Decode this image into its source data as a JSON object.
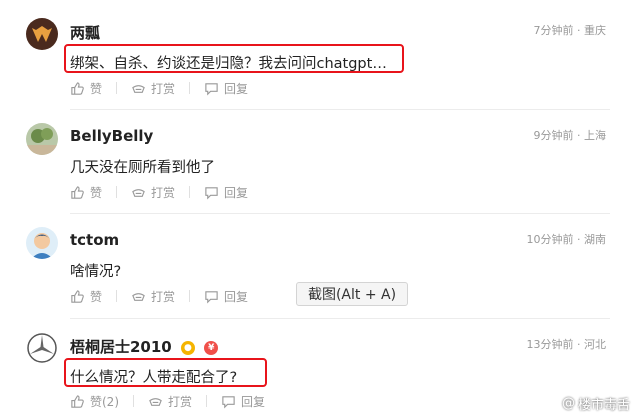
{
  "comments": [
    {
      "username": "两瓢",
      "time": "7分钟前",
      "location": "重庆",
      "text": "绑架、自杀、约谈还是归隐？我去问问chatgpt…",
      "like_label": "赞",
      "reward_label": "打赏",
      "reply_label": "回复"
    },
    {
      "username": "BellyBelly",
      "time": "9分钟前",
      "location": "上海",
      "text": "几天没在厕所看到他了",
      "like_label": "赞",
      "reward_label": "打赏",
      "reply_label": "回复"
    },
    {
      "username": "tctom",
      "time": "10分钟前",
      "location": "湖南",
      "text": "啥情况?",
      "like_label": "赞",
      "reward_label": "打赏",
      "reply_label": "回复"
    },
    {
      "username": "梧桐居士2010",
      "badge_text": "¥",
      "time": "13分钟前",
      "location": "河北",
      "text": "什么情况？人带走配合了?",
      "like_label": "赞(2)",
      "reward_label": "打赏",
      "reply_label": "回复"
    }
  ],
  "separator_dot": "·",
  "tooltip": "截图(Alt + A)",
  "watermark": "楼市毒舌",
  "watermark_prefix": "@",
  "colors": {
    "highlight_border": "#e8141b",
    "meta_text": "#999999"
  },
  "icons": [
    "thumbs-up-icon",
    "reward-icon",
    "reply-icon"
  ]
}
